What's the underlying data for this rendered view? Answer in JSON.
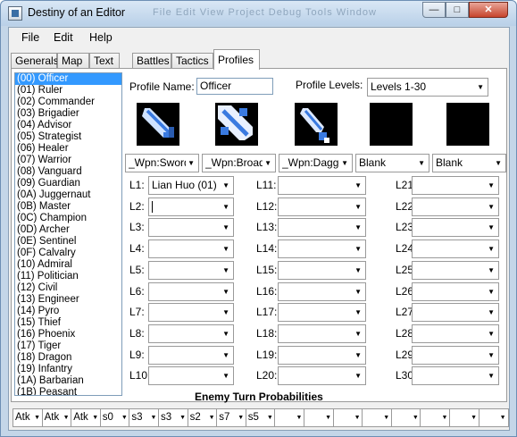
{
  "window": {
    "title": "Destiny of an Editor",
    "ghost_text": "File  Edit  View  Project  Debug  Tools  Window"
  },
  "window_buttons": {
    "minimize": "—",
    "maximize": "□",
    "close": "✕"
  },
  "menu": [
    "File",
    "Edit",
    "Help"
  ],
  "tabs": [
    "Generals",
    "Map",
    "Text",
    "Battles",
    "Tactics",
    "Profiles"
  ],
  "active_tab": "Profiles",
  "officer_list": [
    "(00) Officer",
    "(01) Ruler",
    "(02) Commander",
    "(03) Brigadier",
    "(04) Advisor",
    "(05) Strategist",
    "(06) Healer",
    "(07) Warrior",
    "(08) Vanguard",
    "(09) Guardian",
    "(0A) Juggernaut",
    "(0B) Master",
    "(0C) Champion",
    "(0D) Archer",
    "(0E) Sentinel",
    "(0F) Calvalry",
    "(10) Admiral",
    "(11) Politician",
    "(12) Civil",
    "(13) Engineer",
    "(14) Pyro",
    "(15) Thief",
    "(16) Phoenix",
    "(17) Tiger",
    "(18) Dragon",
    "(19) Infantry",
    "(1A) Barbarian",
    "(1B) Peasant"
  ],
  "selected_index": 0,
  "profile": {
    "name_label": "Profile Name:",
    "name_value": "Officer",
    "levels_label": "Profile Levels:",
    "levels_value": "Levels 1-30"
  },
  "icon_slots": [
    "sword-icon",
    "broadsword-icon",
    "dagger-icon",
    "blank-icon",
    "blank-icon"
  ],
  "weapon_combos": [
    "_Wpn:Sword",
    "_Wpn:Broadsw",
    "_Wpn:Dagge",
    "Blank",
    "Blank"
  ],
  "level_labels": [
    "L1:",
    "L2:",
    "L3:",
    "L4:",
    "L5:",
    "L6:",
    "L7:",
    "L8:",
    "L9:",
    "L10",
    "L11:",
    "L12:",
    "L13:",
    "L14:",
    "L15:",
    "L16:",
    "L17:",
    "L18:",
    "L19:",
    "L20:",
    "L21:",
    "L22:",
    "L23:",
    "L24:",
    "L25:",
    "L26:",
    "L27:",
    "L28:",
    "L29:",
    "L30:"
  ],
  "level_values": [
    "Lian Huo (01)",
    "",
    "",
    "",
    "",
    "",
    "",
    "",
    "",
    "",
    "",
    "",
    "",
    "",
    "",
    "",
    "",
    "",
    "",
    "",
    "",
    "",
    "",
    "",
    "",
    "",
    "",
    "",
    "",
    ""
  ],
  "enemy_title": "Enemy Turn Probabilities",
  "enemy_combos": [
    "Atk",
    "Atk",
    "Atk",
    "s0",
    "s3",
    "s3",
    "s2",
    "s7",
    "s5",
    "",
    "",
    "",
    "",
    "",
    "",
    "",
    ""
  ],
  "colors": {
    "selection": "#3399ff",
    "icon_blue": "#3a7ae0",
    "frame": "#c4d6e8"
  }
}
